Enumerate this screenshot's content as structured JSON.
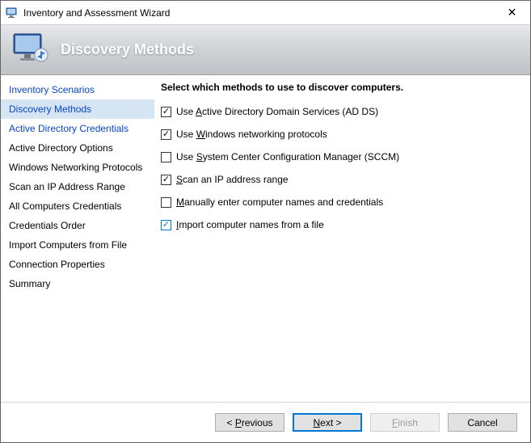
{
  "window": {
    "title": "Inventory and Assessment Wizard",
    "close_glyph": "✕"
  },
  "banner": {
    "heading": "Discovery Methods"
  },
  "sidebar": {
    "items": [
      {
        "label": "Inventory Scenarios",
        "link": true,
        "active": false
      },
      {
        "label": "Discovery Methods",
        "link": true,
        "active": true
      },
      {
        "label": "Active Directory Credentials",
        "link": true,
        "active": false
      },
      {
        "label": "Active Directory Options",
        "link": false,
        "active": false
      },
      {
        "label": "Windows Networking Protocols",
        "link": false,
        "active": false
      },
      {
        "label": "Scan an IP Address Range",
        "link": false,
        "active": false
      },
      {
        "label": "All Computers Credentials",
        "link": false,
        "active": false
      },
      {
        "label": "Credentials Order",
        "link": false,
        "active": false
      },
      {
        "label": "Import Computers from File",
        "link": false,
        "active": false
      },
      {
        "label": "Connection Properties",
        "link": false,
        "active": false
      },
      {
        "label": "Summary",
        "link": false,
        "active": false
      }
    ]
  },
  "main": {
    "heading": "Select which methods to use to discover computers.",
    "options": [
      {
        "checked": true,
        "blue": false,
        "pre": "Use ",
        "u": "A",
        "post": "ctive Directory Domain Services (AD DS)"
      },
      {
        "checked": true,
        "blue": false,
        "pre": "Use ",
        "u": "W",
        "post": "indows networking protocols"
      },
      {
        "checked": false,
        "blue": false,
        "pre": "Use ",
        "u": "S",
        "post": "ystem Center Configuration Manager (SCCM)"
      },
      {
        "checked": true,
        "blue": false,
        "pre": "",
        "u": "S",
        "post": "can an IP address range"
      },
      {
        "checked": false,
        "blue": false,
        "pre": "",
        "u": "M",
        "post": "anually enter computer names and credentials"
      },
      {
        "checked": true,
        "blue": true,
        "pre": "",
        "u": "I",
        "post": "mport computer names from a file"
      }
    ]
  },
  "footer": {
    "previous_u": "P",
    "previous_rest": "revious",
    "next_u": "N",
    "next_rest": "ext >",
    "finish_u": "F",
    "finish_rest": "inish",
    "cancel": "Cancel"
  }
}
